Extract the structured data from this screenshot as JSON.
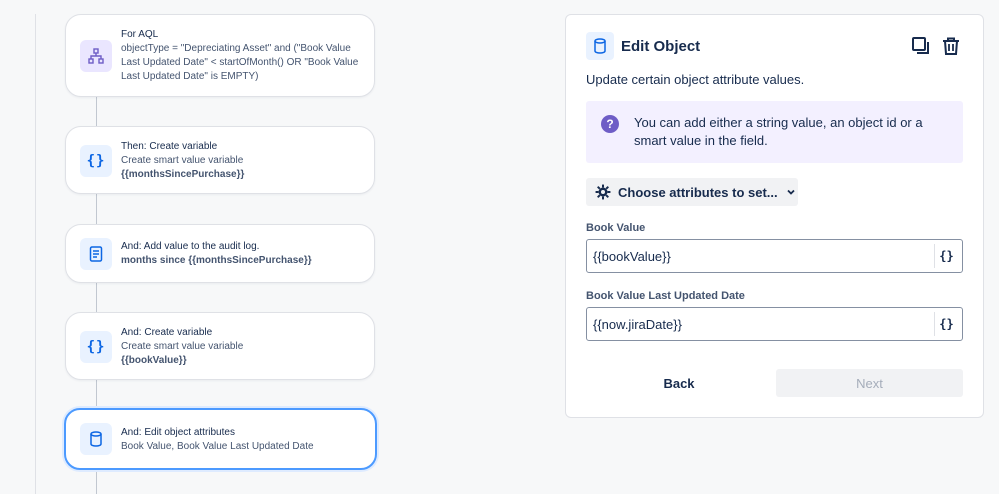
{
  "flow": {
    "steps": [
      {
        "icon": "hierarchy-icon",
        "title": "For AQL",
        "body": "objectType = \"Depreciating Asset\" and (\"Book Value Last Updated Date\" < startOfMonth() OR \"Book Value Last Updated Date\" is EMPTY)"
      },
      {
        "icon": "curly-braces-icon",
        "title": "Then: Create variable",
        "body": "Create smart value variable",
        "strong": "{{monthsSincePurchase}}"
      },
      {
        "icon": "document-icon",
        "title": "And: Add value to the audit log.",
        "strong": "months since {{monthsSincePurchase}}"
      },
      {
        "icon": "curly-braces-icon",
        "title": "And: Create variable",
        "body": "Create smart value variable",
        "strong": "{{bookValue}}"
      },
      {
        "icon": "database-icon",
        "title": "And: Edit object attributes",
        "body": "Book Value, Book Value Last Updated Date",
        "selected": true
      }
    ]
  },
  "panel": {
    "title": "Edit Object",
    "description": "Update certain object attribute values.",
    "info": "You can add either a string value, an object id or a smart value in the field.",
    "choose_label": "Choose attributes to set...",
    "fields": [
      {
        "label": "Book Value",
        "value": "{{bookValue}}",
        "smart": "{}"
      },
      {
        "label": "Book Value Last Updated Date",
        "value": "{{now.jiraDate}}",
        "smart": "{}"
      }
    ],
    "back_label": "Back",
    "next_label": "Next"
  },
  "colors": {
    "accent": "#0c66e4",
    "selected_border": "#4c9aff",
    "info_bg": "#f3f0ff",
    "info_icon": "#6e5dc6"
  }
}
